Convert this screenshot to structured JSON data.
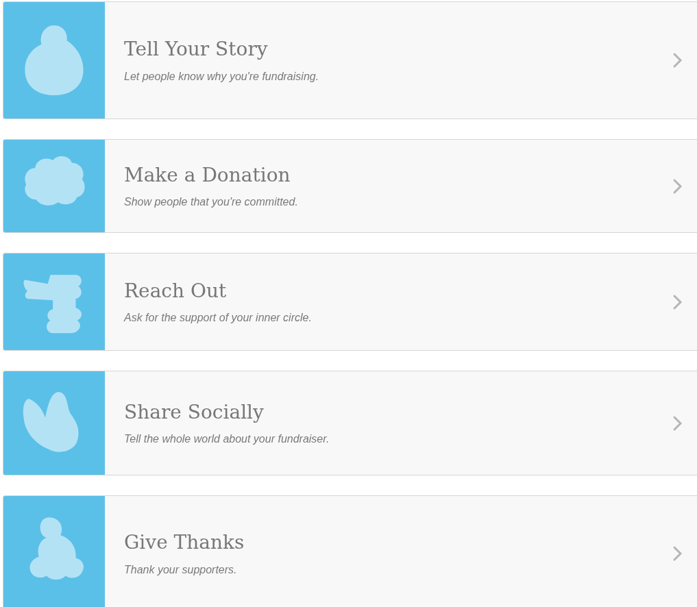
{
  "steps": [
    {
      "title": "Tell Your Story",
      "subtitle": "Let people know why you're fundraising."
    },
    {
      "title": "Make a Donation",
      "subtitle": "Show people that you're committed."
    },
    {
      "title": "Reach Out",
      "subtitle": "Ask for the support of your inner circle."
    },
    {
      "title": "Share Socially",
      "subtitle": "Tell the whole world about your fundraiser."
    },
    {
      "title": "Give Thanks",
      "subtitle": "Thank your supporters."
    }
  ]
}
